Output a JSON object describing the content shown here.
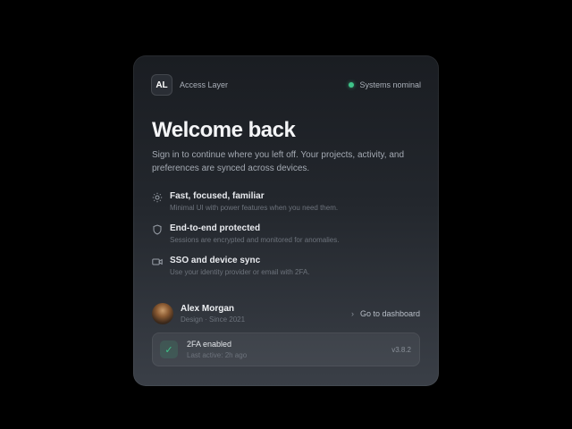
{
  "header": {
    "logo_initials": "AL",
    "brand_name": "Access Layer",
    "status_text": "Systems nominal",
    "status_color": "#3fc48a"
  },
  "main": {
    "title": "Welcome back",
    "subtitle": "Sign in to continue where you left off. Your projects, activity, and preferences are synced across devices."
  },
  "features": [
    {
      "icon": "sun-icon",
      "title": "Fast, focused, familiar",
      "description": "Minimal UI with power features when you need them."
    },
    {
      "icon": "shield-icon",
      "title": "End-to-end protected",
      "description": "Sessions are encrypted and monitored for anomalies."
    },
    {
      "icon": "video-icon",
      "title": "SSO and device sync",
      "description": "Use your identity provider or email with 2FA."
    }
  ],
  "user": {
    "name": "Alex Morgan",
    "meta": "Design · Since 2021",
    "dashboard_link": "Go to dashboard"
  },
  "security": {
    "icon": "check-icon",
    "title": "2FA enabled",
    "last_active": "Last active: 2h ago",
    "version": "v3.8.2"
  }
}
